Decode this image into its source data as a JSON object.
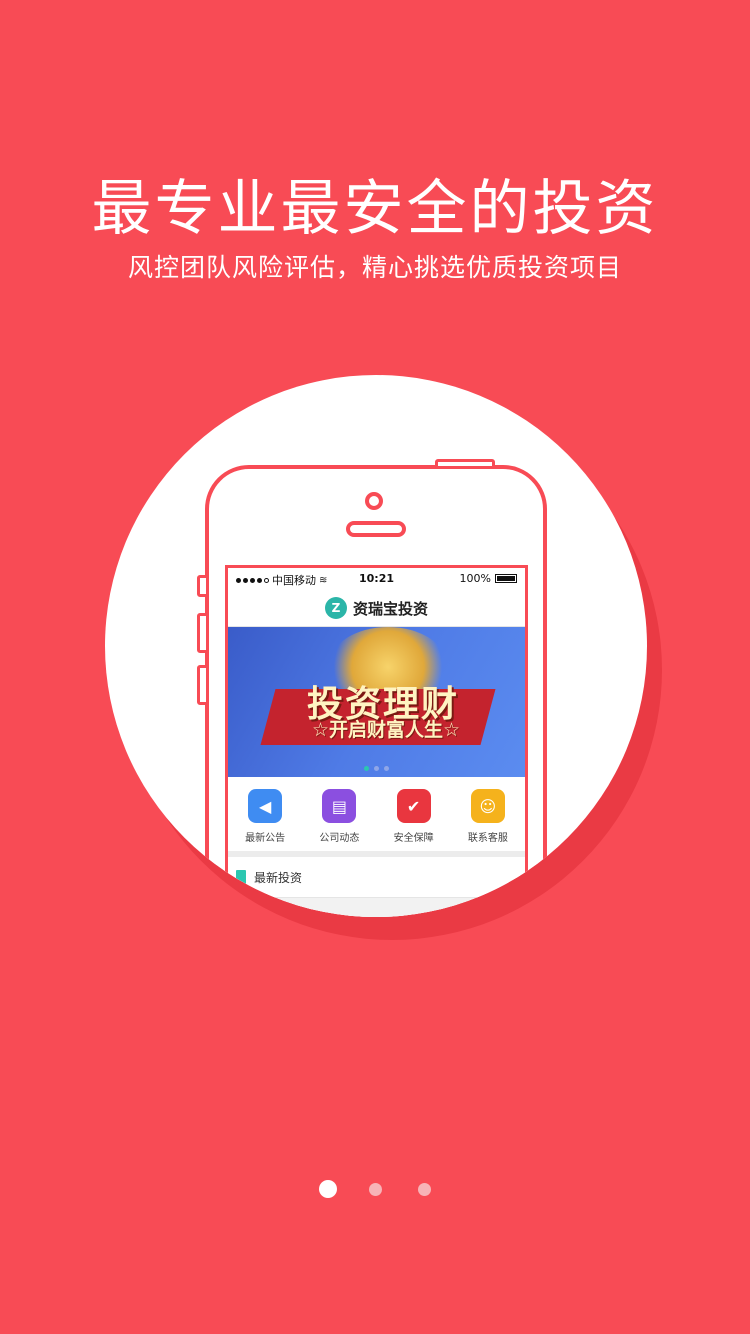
{
  "headline": "最专业最安全的投资",
  "subline": "风控团队风险评估，精心挑选优质投资项目",
  "phone": {
    "status": {
      "carrier": "中国移动",
      "time": "10:21",
      "battery": "100%"
    },
    "app_logo_letter": "Z",
    "app_title": "资瑞宝投资",
    "banner": {
      "line1": "投资理财",
      "line2": "☆开启财富人生☆"
    },
    "quick_nav": [
      {
        "label": "最新公告",
        "icon": "megaphone-icon",
        "color": "#3f8cf2",
        "glyph": "📢"
      },
      {
        "label": "公司动态",
        "icon": "news-icon",
        "color": "#8b4fe0",
        "glyph": "▤"
      },
      {
        "label": "安全保障",
        "icon": "shield-icon",
        "color": "#e9363f",
        "glyph": "✔"
      },
      {
        "label": "联系客服",
        "icon": "headset-icon",
        "color": "#f5b21c",
        "glyph": "☺"
      }
    ],
    "latest_section": "最新投资"
  },
  "pager": {
    "count": 3,
    "active_index": 0
  },
  "colors": {
    "background": "#f84b55",
    "accent": "#2bc7b0"
  }
}
